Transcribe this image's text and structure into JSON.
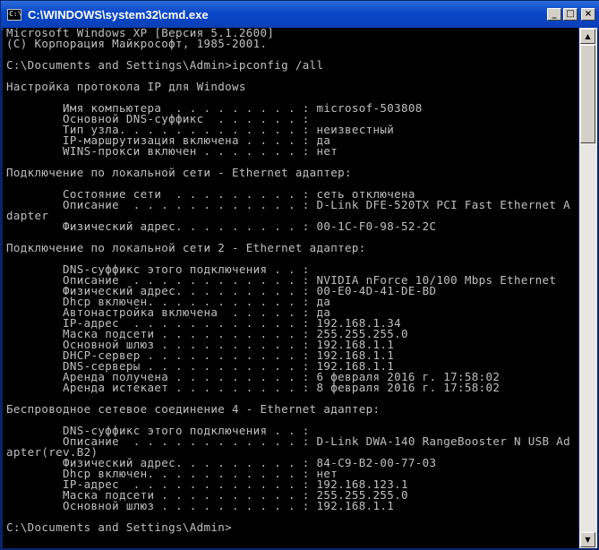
{
  "window": {
    "title": "C:\\WINDOWS\\system32\\cmd.exe",
    "icon_label": "C:\\",
    "buttons": {
      "minimize": "_",
      "maximize": "□",
      "close": "×"
    }
  },
  "scrollbar": {
    "up_arrow": "▲",
    "down_arrow": "▼"
  },
  "console": {
    "lines": [
      "Microsoft Windows XP [Версия 5.1.2600]",
      "(С) Корпорация Майкрософт, 1985-2001.",
      "",
      "C:\\Documents and Settings\\Admin>ipconfig /all",
      "",
      "Настройка протокола IP для Windows",
      "",
      "        Имя компьютера  . . . . . . . . . : microsof-503808",
      "        Основной DNS-суффикс  . . . . . . :",
      "        Тип узла. . . . . . . . . . . . . : неизвестный",
      "        IP-маршрутизация включена . . . . : да",
      "        WINS-прокси включен . . . . . . . : нет",
      "",
      "Подключение по локальной сети - Ethernet адаптер:",
      "",
      "        Состояние сети  . . . . . . . . . : сеть отключена",
      "        Описание  . . . . . . . . . . . . : D-Link DFE-520TX PCI Fast Ethernet A",
      "dapter",
      "        Физический адрес. . . . . . . . . : 00-1C-F0-98-52-2C",
      "",
      "Подключение по локальной сети 2 - Ethernet адаптер:",
      "",
      "        DNS-суффикс этого подключения . . :",
      "        Описание  . . . . . . . . . . . . : NVIDIA nForce 10/100 Mbps Ethernet",
      "        Физический адрес. . . . . . . . . : 00-E0-4D-41-DE-BD",
      "        Dhcp включен. . . . . . . . . . . : да",
      "        Автонастройка включена  . . . . . : да",
      "        IP-адрес  . . . . . . . . . . . . : 192.168.1.34",
      "        Маска подсети . . . . . . . . . . : 255.255.255.0",
      "        Основной шлюз . . . . . . . . . . : 192.168.1.1",
      "        DHCP-сервер . . . . . . . . . . . : 192.168.1.1",
      "        DNS-серверы . . . . . . . . . . . : 192.168.1.1",
      "        Аренда получена . . . . . . . . . : 6 февраля 2016 г. 17:58:02",
      "        Аренда истекает . . . . . . . . . : 8 февраля 2016 г. 17:58:02",
      "",
      "Беспроводное сетевое соединение 4 - Ethernet адаптер:",
      "",
      "        DNS-суффикс этого подключения . . :",
      "        Описание  . . . . . . . . . . . . : D-Link DWA-140 RangeBooster N USB Ad",
      "apter(rev.B2)",
      "        Физический адрес. . . . . . . . . : 84-C9-B2-00-77-03",
      "        Dhcp включен. . . . . . . . . . . : нет",
      "        IP-адрес  . . . . . . . . . . . . : 192.168.123.1",
      "        Маска подсети . . . . . . . . . . : 255.255.255.0",
      "        Основной шлюз . . . . . . . . . . : 192.168.1.1",
      "",
      "C:\\Documents and Settings\\Admin>"
    ]
  }
}
